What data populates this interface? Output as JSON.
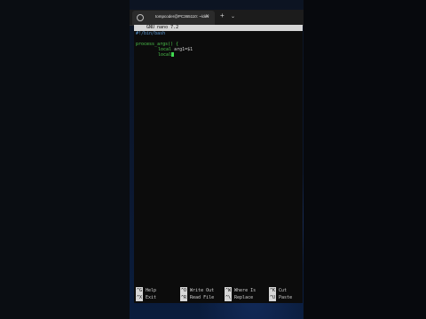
{
  "tab": {
    "title": "tompcoder@PC365110: ~/dev",
    "close": "✕"
  },
  "tabbar": {
    "new_tab": "+",
    "dropdown": "⌄"
  },
  "nano": {
    "header": "GNU nano 7.2"
  },
  "editor": {
    "lines": [
      {
        "text": "#!/bin/bash"
      },
      {
        "text": ""
      },
      {
        "text": "process_args() {"
      },
      {
        "kw": "local",
        "rest": " arg1=$1"
      },
      {
        "kw": "local",
        "rest": ""
      }
    ]
  },
  "shortcuts": [
    {
      "key": "^G",
      "label": "Help"
    },
    {
      "key": "^O",
      "label": "Write Out"
    },
    {
      "key": "^W",
      "label": "Where Is"
    },
    {
      "key": "^K",
      "label": "Cut"
    },
    {
      "key": "^X",
      "label": "Exit"
    },
    {
      "key": "^R",
      "label": "Read File"
    },
    {
      "key": "^\\",
      "label": "Replace"
    },
    {
      "key": "^U",
      "label": "Paste"
    }
  ]
}
